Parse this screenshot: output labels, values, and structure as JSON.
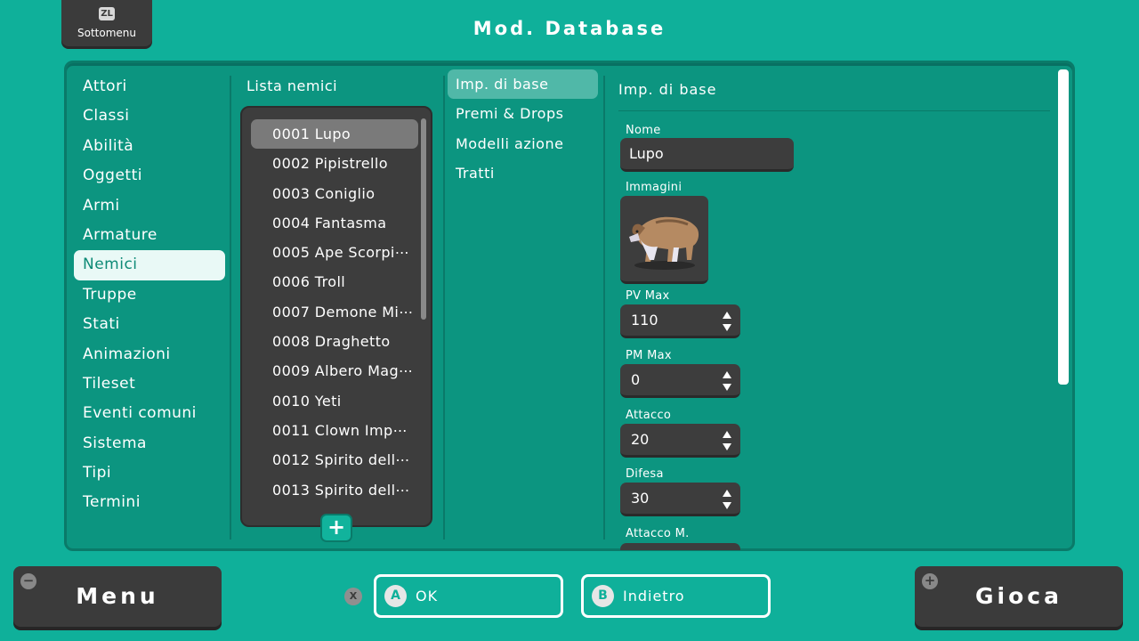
{
  "header": {
    "submenu_key": "ZL",
    "submenu_label": "Sottomenu",
    "title": "Mod. Database"
  },
  "categories": [
    {
      "label": "Attori"
    },
    {
      "label": "Classi"
    },
    {
      "label": "Abilità"
    },
    {
      "label": "Oggetti"
    },
    {
      "label": "Armi"
    },
    {
      "label": "Armature"
    },
    {
      "label": "Nemici",
      "selected": true
    },
    {
      "label": "Truppe"
    },
    {
      "label": "Stati"
    },
    {
      "label": "Animazioni"
    },
    {
      "label": "Tileset"
    },
    {
      "label": "Eventi comuni"
    },
    {
      "label": "Sistema"
    },
    {
      "label": "Tipi"
    },
    {
      "label": "Termini"
    }
  ],
  "enemies": {
    "heading": "Lista nemici",
    "add_label": "+",
    "items": [
      {
        "label": "0001 Lupo",
        "selected": true
      },
      {
        "label": "0002 Pipistrello"
      },
      {
        "label": "0003 Coniglio"
      },
      {
        "label": "0004 Fantasma"
      },
      {
        "label": "0005 Ape Scorpi⋯"
      },
      {
        "label": "0006 Troll"
      },
      {
        "label": "0007 Demone Mi⋯"
      },
      {
        "label": "0008 Draghetto"
      },
      {
        "label": "0009 Albero Mag⋯"
      },
      {
        "label": "0010 Yeti"
      },
      {
        "label": "0011 Clown Imp⋯"
      },
      {
        "label": "0012 Spirito dell⋯"
      },
      {
        "label": "0013 Spirito dell⋯"
      }
    ]
  },
  "sections": [
    {
      "label": "Imp. di base",
      "selected": true
    },
    {
      "label": "Premi & Drops"
    },
    {
      "label": "Modelli azione"
    },
    {
      "label": "Tratti"
    }
  ],
  "detail": {
    "heading": "Imp. di base",
    "name_label": "Nome",
    "name_value": "Lupo",
    "image_label": "Immagini",
    "image_icon": "wolf-sprite",
    "pv_label": "PV Max",
    "pv_value": "110",
    "pm_label": "PM Max",
    "pm_value": "0",
    "atk_label": "Attacco",
    "atk_value": "20",
    "def_label": "Difesa",
    "def_value": "30",
    "matk_label": "Attacco M."
  },
  "footer": {
    "menu_label": "Menu",
    "menu_icon": "−",
    "x_key": "X",
    "ok_key": "A",
    "ok_label": "OK",
    "back_key": "B",
    "back_label": "Indietro",
    "play_label": "Gioca",
    "play_icon": "+"
  }
}
